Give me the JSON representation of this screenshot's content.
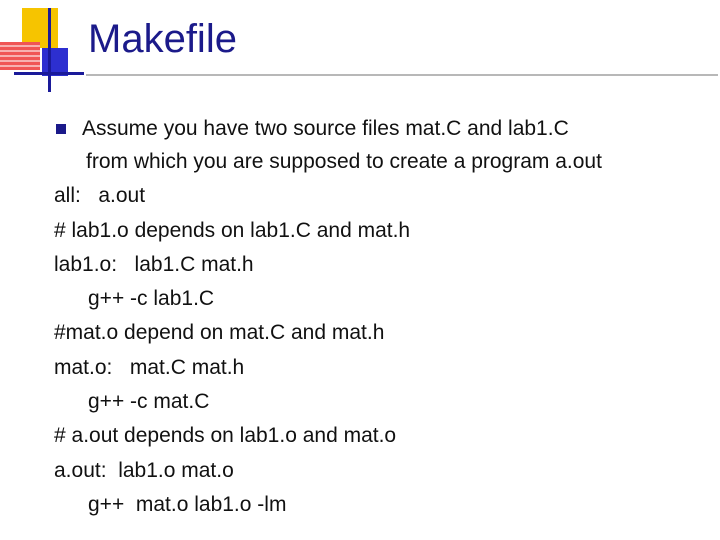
{
  "slide": {
    "title": "Makefile",
    "bullet": {
      "line1": "Assume you have two source files mat.C and lab1.C",
      "line2": "from which you are supposed to create a program a.out"
    },
    "code": [
      "all:   a.out",
      "# lab1.o depends on lab1.C and mat.h",
      "lab1.o:   lab1.C mat.h",
      "g++ -c lab1.C",
      "#mat.o depend on mat.C and mat.h",
      "mat.o:   mat.C mat.h",
      "g++ -c mat.C",
      "# a.out depends on lab1.o and mat.o",
      "a.out:  lab1.o mat.o",
      "g++  mat.o lab1.o -lm"
    ]
  },
  "colors": {
    "title": "#1b1a8a",
    "bullet": "#1b1a8a",
    "logo_yellow": "#f6c400",
    "logo_red": "#ee2222",
    "logo_blue": "#2d2fd0"
  }
}
